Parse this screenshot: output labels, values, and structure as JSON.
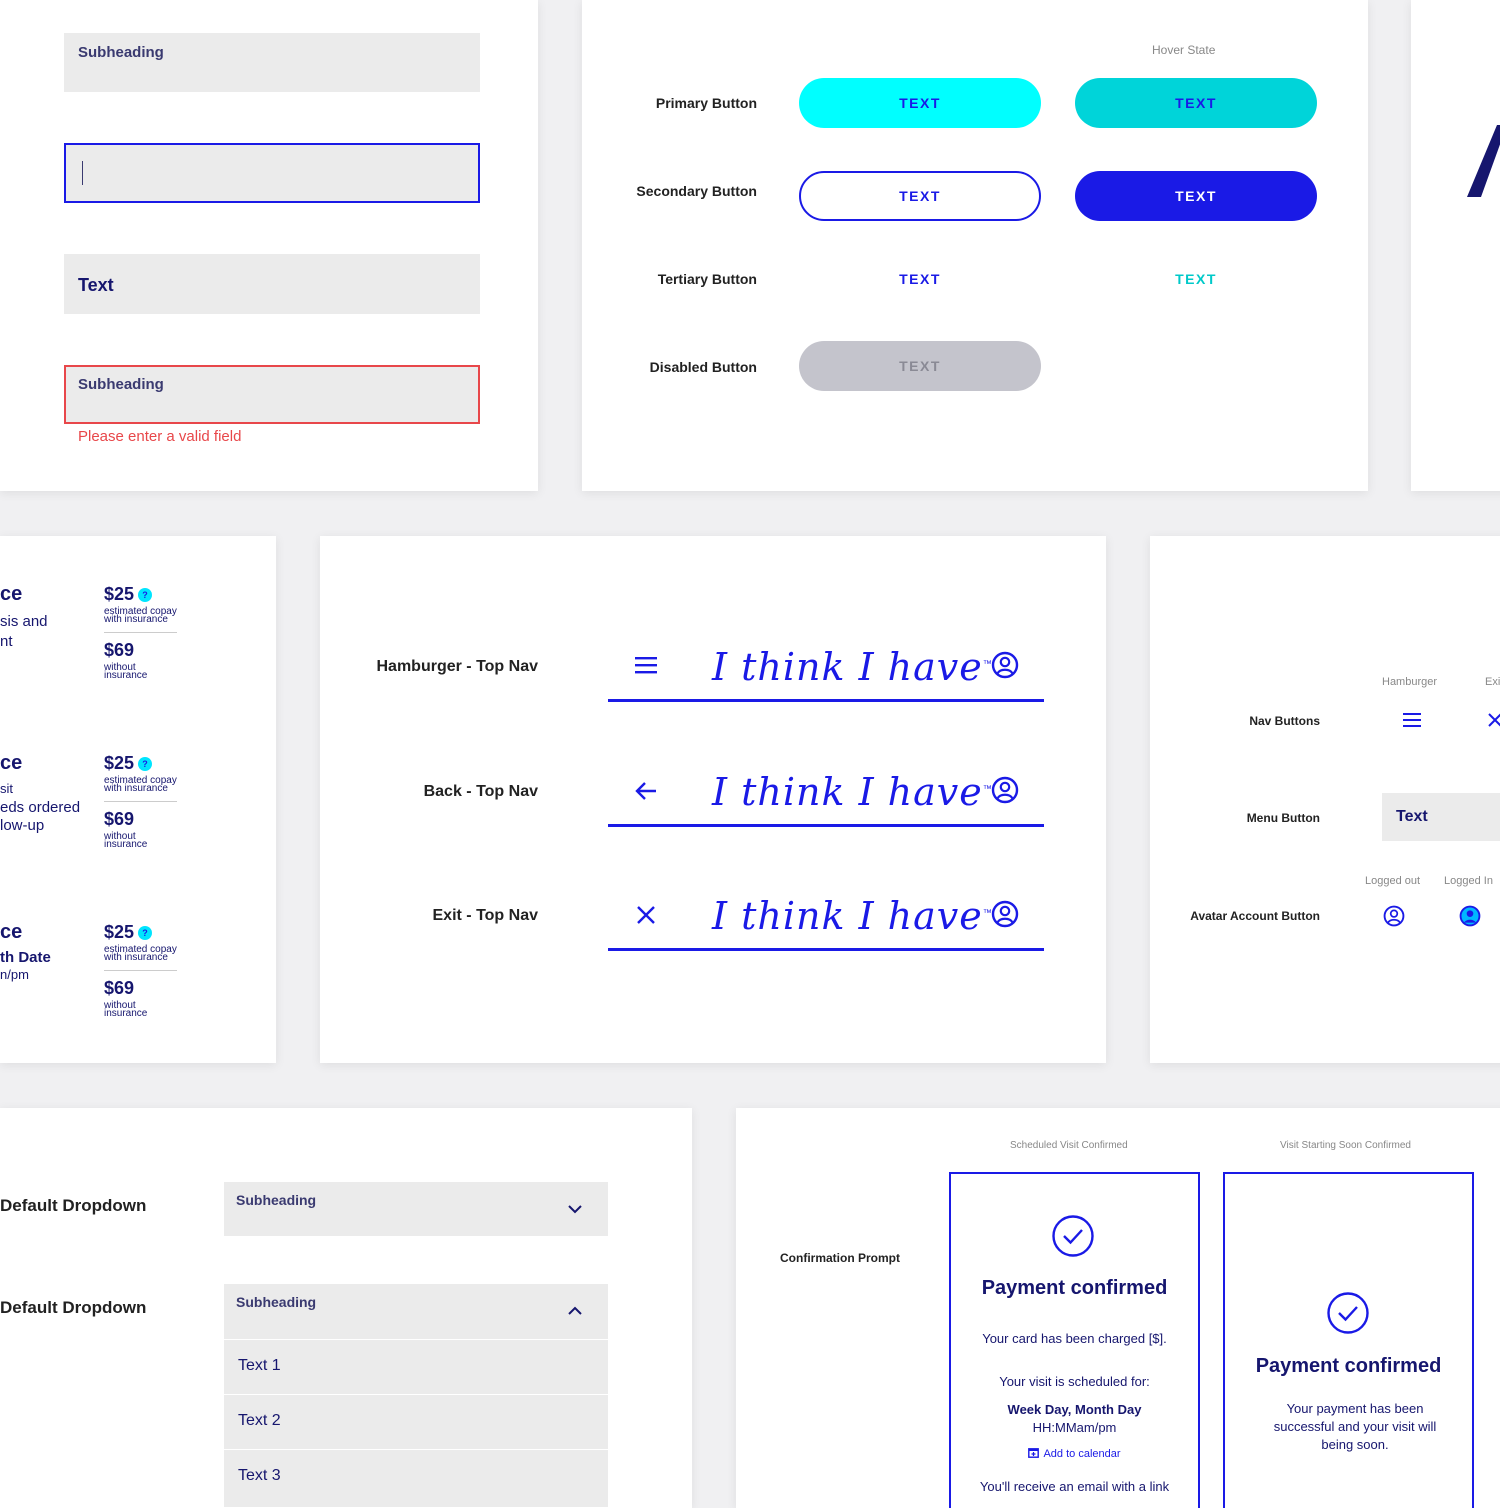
{
  "inputs": {
    "subheading_label": "Subheading",
    "text_label": "Text",
    "error_label": "Subheading",
    "error_message": "Please enter a valid field"
  },
  "buttons": {
    "hover_state_label": "Hover State",
    "rows": [
      {
        "label": "Primary Button",
        "text": "TEXT",
        "hover_text": "TEXT"
      },
      {
        "label": "Secondary Button",
        "text": "TEXT",
        "hover_text": "TEXT"
      },
      {
        "label": "Tertiary Button",
        "text": "TEXT",
        "hover_text": "TEXT"
      },
      {
        "label": "Disabled Button",
        "text": "TEXT"
      }
    ]
  },
  "pricing": {
    "rows": [
      {
        "title_fragment": "ce",
        "desc": [
          "sis and",
          "nt"
        ],
        "copay": "$25",
        "copay_note": [
          "estimated copay",
          "with insurance"
        ],
        "full": "$69",
        "full_note": [
          "without",
          "insurance"
        ]
      },
      {
        "title_fragment": "ce",
        "desc": [
          "sit",
          "eds ordered",
          "low-up"
        ],
        "copay": "$25",
        "copay_note": [
          "estimated copay",
          "with insurance"
        ],
        "full": "$69",
        "full_note": [
          "without",
          "insurance"
        ]
      },
      {
        "title_fragment": "ce",
        "desc": [
          "th Date",
          "n/pm"
        ],
        "copay": "$25",
        "copay_note": [
          "estimated copay",
          "with insurance"
        ],
        "full": "$69",
        "full_note": [
          "without",
          "insurance"
        ]
      }
    ],
    "help_mark": "?"
  },
  "top_nav": {
    "logo_text": "I think I have",
    "trademark": "™",
    "rows": [
      {
        "label": "Hamburger - Top Nav",
        "icon": "hamburger-icon"
      },
      {
        "label": "Back - Top Nav",
        "icon": "back-arrow-icon"
      },
      {
        "label": "Exit - Top Nav",
        "icon": "close-icon"
      }
    ]
  },
  "nav_buttons": {
    "hamburger_label": "Hamburger",
    "exit_label": "Exi",
    "nav_buttons_label": "Nav Buttons",
    "menu_button_label": "Menu Button",
    "menu_button_text": "Text",
    "logged_out_label": "Logged out",
    "logged_in_label": "Logged In",
    "avatar_label": "Avatar Account Button"
  },
  "dropdowns": {
    "closed_label": "Default Dropdown",
    "open_label": "Default Dropdown",
    "closed_value": "Subheading",
    "open_value": "Subheading",
    "options": [
      "Text 1",
      "Text 2",
      "Text 3"
    ]
  },
  "confirmation": {
    "prompt_label": "Confirmation Prompt",
    "scheduled_label": "Scheduled Visit Confirmed",
    "starting_label": "Visit Starting Soon Confirmed",
    "card1": {
      "title": "Payment confirmed",
      "charged": "Your card has been charged [$].",
      "scheduled_for": "Your visit is scheduled for:",
      "date": "Week Day, Month Day",
      "time": "HH:MMam/pm",
      "calendar_link": "Add to calendar",
      "email_note": "You'll receive an email with a link"
    },
    "card2": {
      "title": "Payment confirmed",
      "body": [
        "Your payment has been",
        "successful and your visit will",
        "being soon."
      ]
    }
  },
  "colors": {
    "navy": "#16166e",
    "blue": "#1a1ae6",
    "cyan": "#00ffff",
    "cyan_hover": "#00d4d9",
    "error": "#e8474a",
    "disabled": "#c4c4cc"
  }
}
